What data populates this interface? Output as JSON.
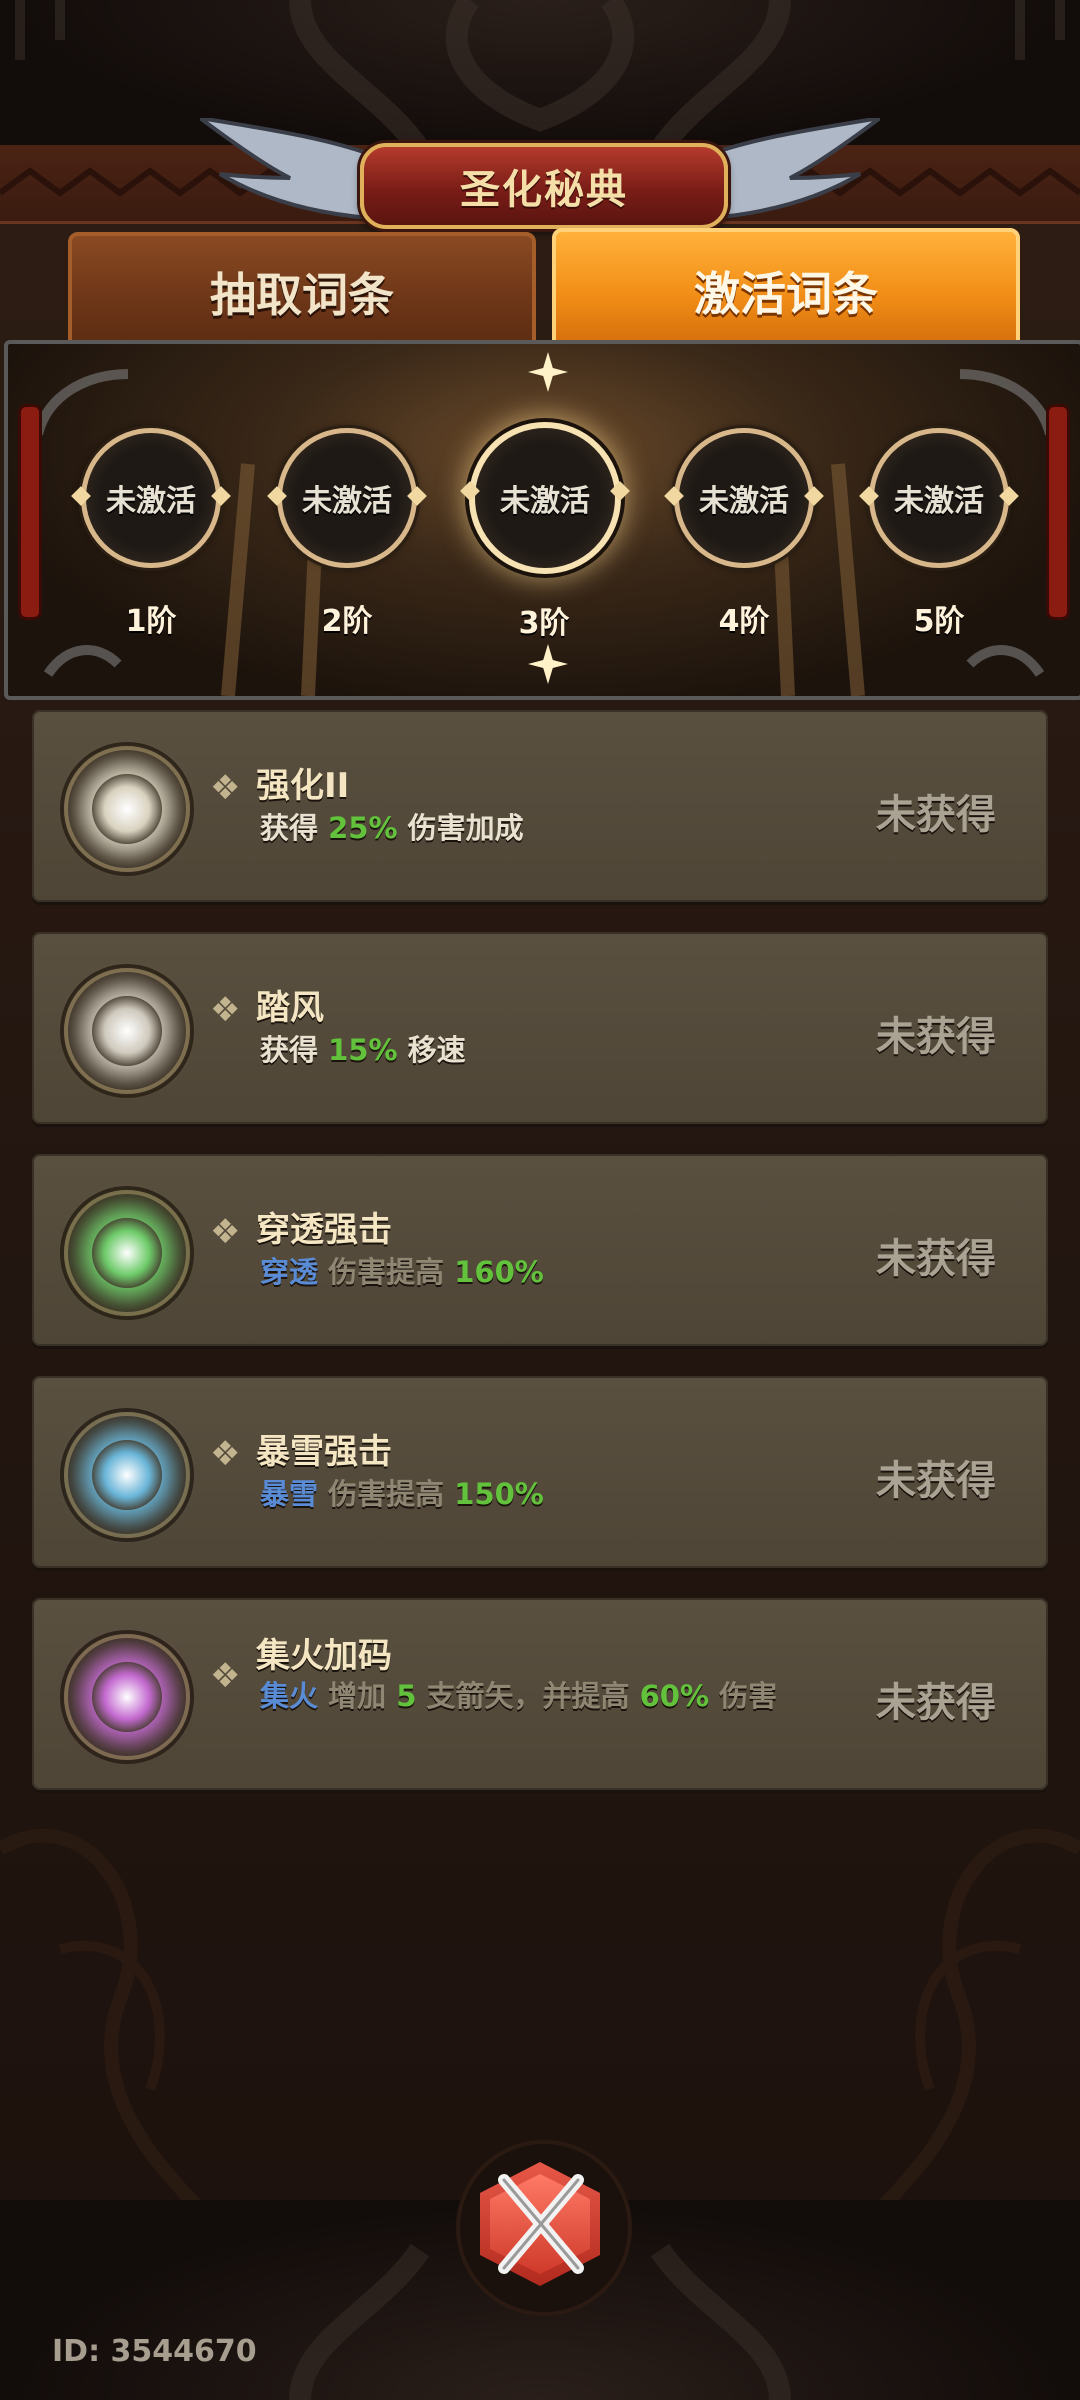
{
  "header": {
    "title": "圣化秘典"
  },
  "tabs": [
    {
      "label": "抽取词条",
      "selected": false
    },
    {
      "label": "激活词条",
      "selected": true
    }
  ],
  "tiers": [
    {
      "status": "未激活",
      "label": "1阶",
      "active": false
    },
    {
      "status": "未激活",
      "label": "2阶",
      "active": false
    },
    {
      "status": "未激活",
      "label": "3阶",
      "active": true
    },
    {
      "status": "未激活",
      "label": "4阶",
      "active": false
    },
    {
      "status": "未激活",
      "label": "5阶",
      "active": false
    }
  ],
  "entries": [
    {
      "name": "强化II",
      "desc": [
        {
          "text": "获得 ",
          "style": "normal"
        },
        {
          "text": "25%",
          "style": "green"
        },
        {
          "text": " 伤害加成",
          "style": "normal"
        }
      ],
      "status": "未获得",
      "orb_color": "#d9d2c0"
    },
    {
      "name": "踏风",
      "desc": [
        {
          "text": "获得 ",
          "style": "normal"
        },
        {
          "text": "15%",
          "style": "green"
        },
        {
          "text": " 移速",
          "style": "normal"
        }
      ],
      "status": "未获得",
      "orb_color": "#cfc9bd"
    },
    {
      "name": "穿透强击",
      "desc": [
        {
          "text": "穿透",
          "style": "blue"
        },
        {
          "text": " 伤害提高 ",
          "style": "gray"
        },
        {
          "text": "160%",
          "style": "green"
        }
      ],
      "status": "未获得",
      "orb_color": "#6ecb6a"
    },
    {
      "name": "暴雪强击",
      "desc": [
        {
          "text": "暴雪",
          "style": "blue"
        },
        {
          "text": " 伤害提高 ",
          "style": "gray"
        },
        {
          "text": "150%",
          "style": "green"
        }
      ],
      "status": "未获得",
      "orb_color": "#69b5d8"
    },
    {
      "name": "集火加码",
      "desc": [
        {
          "text": "集火",
          "style": "blue"
        },
        {
          "text": " 增加 ",
          "style": "gray"
        },
        {
          "text": "5",
          "style": "green"
        },
        {
          "text": " 支箭矢，并提高 ",
          "style": "gray"
        },
        {
          "text": "60%",
          "style": "green"
        },
        {
          "text": " 伤害",
          "style": "gray"
        }
      ],
      "status": "未获得",
      "orb_color": "#c46ad0"
    }
  ],
  "footer": {
    "id_text": "ID: 3544670"
  },
  "colors": {
    "accent_orange": "#f18d16",
    "highlight_green": "#62c23b",
    "keyword_blue": "#5a8cd6"
  }
}
